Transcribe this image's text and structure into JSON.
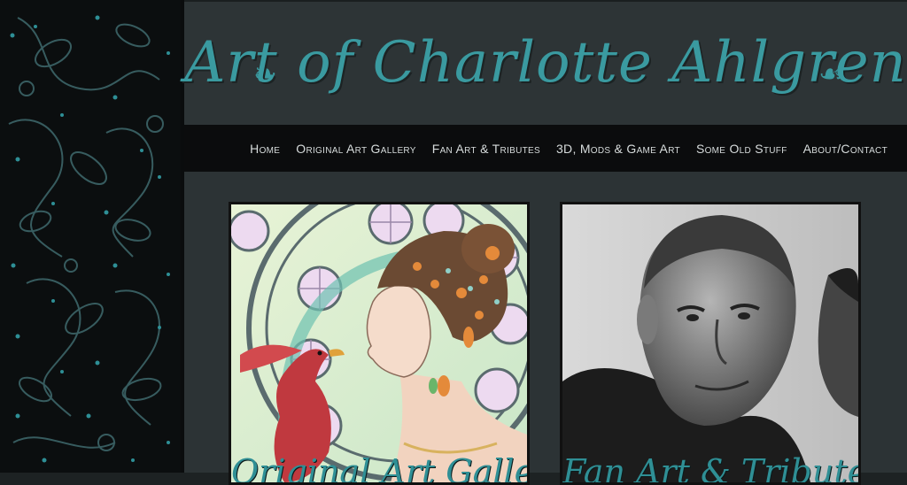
{
  "site": {
    "title": "Art of Charlotte Ahlgren"
  },
  "nav": {
    "items": [
      {
        "label": "Home"
      },
      {
        "label": "Original Art Gallery"
      },
      {
        "label": "Fan Art & Tributes"
      },
      {
        "label": "3D, Mods & Game Art"
      },
      {
        "label": "Some Old Stuff"
      },
      {
        "label": "About/Contact"
      }
    ]
  },
  "gallery": {
    "cards": [
      {
        "caption": "Original Art Gallery"
      },
      {
        "caption": "Fan Art & Tributes"
      }
    ]
  },
  "colors": {
    "accent": "#3a9aa0",
    "nav_bg": "#0b0c0d",
    "header_bg": "#2d3436",
    "panel_bg": "#0b0e0f"
  }
}
